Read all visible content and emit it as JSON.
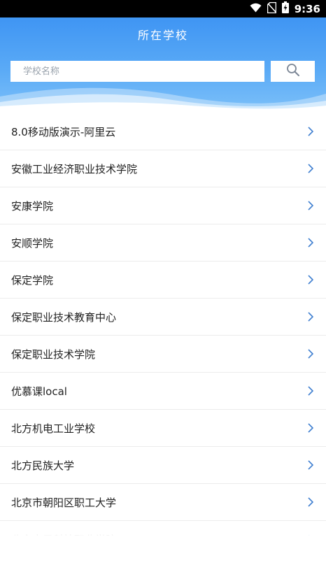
{
  "status_bar": {
    "time": "9:36",
    "icons": [
      "wifi-icon",
      "no-sim-icon",
      "battery-charging-icon"
    ]
  },
  "header": {
    "title": "所在学校",
    "search_placeholder": "学校名称",
    "search_value": "",
    "search_button_icon": "search-icon"
  },
  "colors": {
    "header_top": "#3f95f3",
    "header_bottom": "#7cc0f9",
    "chevron": "#3f7fd0",
    "text": "#222222",
    "divider": "#ececec"
  },
  "schools": [
    {
      "name": "8.0移动版演示-阿里云"
    },
    {
      "name": "安徽工业经济职业技术学院"
    },
    {
      "name": "安康学院"
    },
    {
      "name": "安顺学院"
    },
    {
      "name": "保定学院"
    },
    {
      "name": "保定职业技术教育中心"
    },
    {
      "name": "保定职业技术学院"
    },
    {
      "name": "优慕课local"
    },
    {
      "name": "北方机电工业学校"
    },
    {
      "name": "北方民族大学"
    },
    {
      "name": "北京市朝阳区职工大学"
    },
    {
      "name": "北京电子科技职业学院"
    }
  ]
}
